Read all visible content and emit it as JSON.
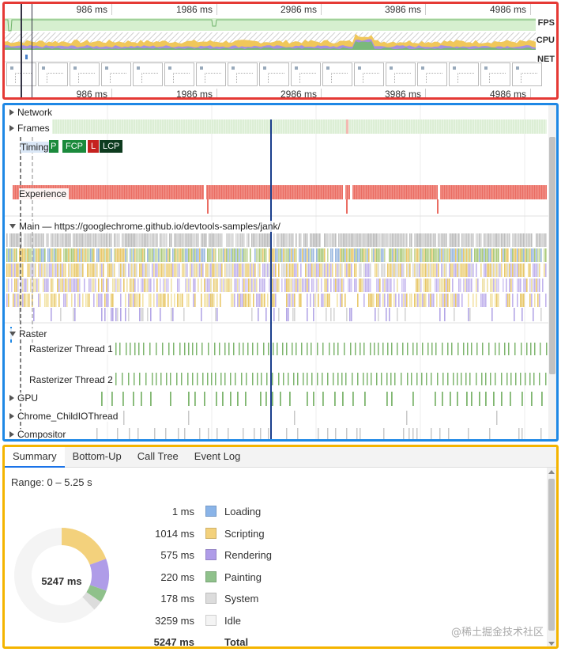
{
  "overview": {
    "time_ticks": [
      "986 ms",
      "1986 ms",
      "2986 ms",
      "3986 ms",
      "4986 ms"
    ],
    "lanes": {
      "fps": "FPS",
      "cpu": "CPU",
      "net": "NET"
    }
  },
  "flame": {
    "tracks": {
      "network": "Network",
      "frames": "Frames",
      "timings": "Timings",
      "experience": "Experience",
      "main": "Main — https://googlechrome.github.io/devtools-samples/jank/",
      "raster": "Raster",
      "rasterizer1": "Rasterizer Thread 1",
      "rasterizer2": "Rasterizer Thread 2",
      "gpu": "GPU",
      "childio": "Chrome_ChildIOThread",
      "compositor": "Compositor"
    },
    "timing_markers": [
      {
        "label": "P",
        "color": "#1b8a3c"
      },
      {
        "label": "FCP",
        "color": "#1b8a3c"
      },
      {
        "label": "L",
        "color": "#c5221f"
      },
      {
        "label": "LCP",
        "color": "#0d3b1e"
      }
    ]
  },
  "summary": {
    "tabs": [
      "Summary",
      "Bottom-Up",
      "Call Tree",
      "Event Log"
    ],
    "active_tab": "Summary",
    "range": "Range: 0 – 5.25 s",
    "total_center": "5247 ms",
    "items": [
      {
        "value": "1 ms",
        "name": "Loading",
        "color": "#8ab4e8"
      },
      {
        "value": "1014 ms",
        "name": "Scripting",
        "color": "#f3d17c"
      },
      {
        "value": "575 ms",
        "name": "Rendering",
        "color": "#af9ce8"
      },
      {
        "value": "220 ms",
        "name": "Painting",
        "color": "#8fc18b"
      },
      {
        "value": "178 ms",
        "name": "System",
        "color": "#dcdcdc"
      },
      {
        "value": "3259 ms",
        "name": "Idle",
        "color": "#f4f4f4"
      }
    ],
    "total": {
      "value": "5247 ms",
      "name": "Total"
    },
    "watermark": "@稀土掘金技术社区"
  }
}
